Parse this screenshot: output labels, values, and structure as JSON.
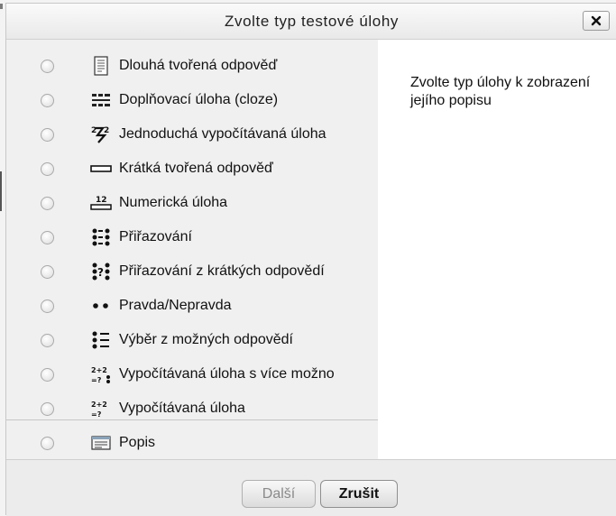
{
  "dialog": {
    "title": "Zvolte typ testové úlohy",
    "close_icon": "close-x-icon"
  },
  "options": [
    {
      "label": "Dlouhá tvořená odpověď",
      "icon": "essay-icon"
    },
    {
      "label": "Doplňovací úloha (cloze)",
      "icon": "cloze-icon"
    },
    {
      "label": "Jednoduchá vypočítávaná úloha",
      "icon": "calculated-simple-icon"
    },
    {
      "label": "Krátká tvořená odpověď",
      "icon": "short-answer-icon"
    },
    {
      "label": "Numerická úloha",
      "icon": "numerical-icon"
    },
    {
      "label": "Přiřazování",
      "icon": "matching-icon"
    },
    {
      "label": "Přiřazování z krátkých odpovědí",
      "icon": "random-short-answer-matching-icon"
    },
    {
      "label": "Pravda/Nepravda",
      "icon": "true-false-icon"
    },
    {
      "label": "Výběr z možných odpovědí",
      "icon": "multiple-choice-icon"
    },
    {
      "label": "Vypočítávaná úloha s více možno",
      "icon": "calculated-multichoice-icon"
    },
    {
      "label": "Vypočítávaná úloha",
      "icon": "calculated-icon"
    },
    {
      "label": "Popis",
      "icon": "description-icon"
    }
  ],
  "description": {
    "text": "Zvolte typ úlohy k zobrazení jejího popisu"
  },
  "footer": {
    "next_label": "Další",
    "cancel_label": "Zrušit"
  }
}
